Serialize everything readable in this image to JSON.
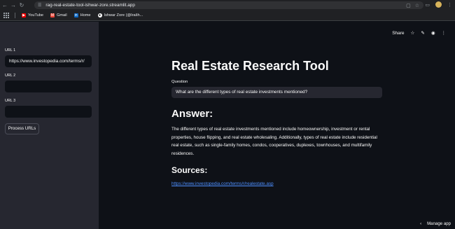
{
  "browser": {
    "url": "rag-real-estate-tool-ishwar-zore.streamlit.app",
    "bookmarks": [
      {
        "label": "YouTube",
        "icon": "youtube-icon",
        "color": "#ff0000"
      },
      {
        "label": "Gmail",
        "icon": "gmail-icon",
        "color": "#ea4335"
      },
      {
        "label": "Home",
        "icon": "linkedin-icon",
        "color": "#0a66c2"
      },
      {
        "label": "Ishwar Zore (@Irašh...",
        "icon": "github-icon",
        "color": "#ffffff"
      }
    ]
  },
  "sidebar": {
    "url1_label": "URL 1",
    "url1_value": "https://www.investopedia.com/terms/r/",
    "url2_label": "URL 2",
    "url2_value": "",
    "url3_label": "URL 3",
    "url3_value": "",
    "process_button": "Process URLs"
  },
  "toolbar": {
    "share_label": "Share"
  },
  "main": {
    "title": "Real Estate Research Tool",
    "question_label": "Question",
    "question_value": "What are the different types of real estate investments mentioned?",
    "answer_heading": "Answer:",
    "answer_text": "The different types of real estate investments mentioned include homeownership, investment or rental properties, house flipping, and real estate wholesaling. Additionally, types of real estate include residential real estate, such as single-family homes, condos, cooperatives, duplexes, townhouses, and multifamily residences.",
    "sources_heading": "Sources:",
    "source_link": "https://www.investopedia.com/terms/r/realestate.asp"
  },
  "footer": {
    "manage_app": "Manage app"
  },
  "colors": {
    "background": "#0e1117",
    "sidebar": "#262730",
    "link": "#4d8fff"
  }
}
